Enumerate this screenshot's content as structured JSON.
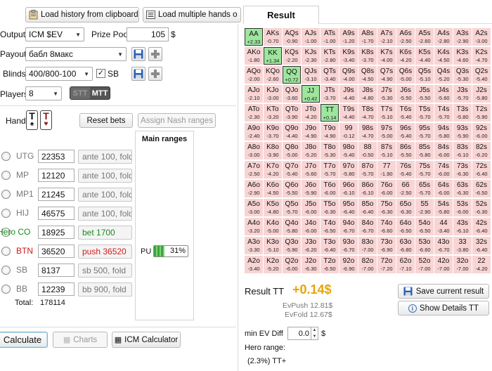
{
  "toolbar": {
    "load_clipboard": "Load history from clipboard",
    "load_multiple": "Load multiple hands o"
  },
  "result_tab": "Result",
  "settings": {
    "output_label": "Output",
    "output_value": "ICM $EV",
    "prize_pool_label": "Prize Pool",
    "prize_pool_value": "105",
    "currency": "$",
    "payout_label": "Payout",
    "payout_value": "бабл 8макс",
    "blinds_label": "Blinds",
    "blinds_value": "400/800-100",
    "sb_label": "SB",
    "players_label": "Players",
    "players_value": "8",
    "stt_label": "STT",
    "mtt_label": "MTT"
  },
  "hand": {
    "label": "Hand",
    "card1": "T",
    "card2": "T",
    "reset_bets": "Reset bets",
    "assign_nash": "Assign Nash ranges"
  },
  "main_ranges": {
    "title": "Main ranges",
    "pu_label": "PU",
    "pu_percent": "31%",
    "pu_fill": 0.31
  },
  "players": [
    {
      "pos": "UTG",
      "stack": "22353",
      "action": "ante 100, fold",
      "color": "gray"
    },
    {
      "pos": "MP",
      "stack": "12120",
      "action": "ante 100, fold",
      "color": "gray"
    },
    {
      "pos": "MP1",
      "stack": "21245",
      "action": "ante 100, fold",
      "color": "gray"
    },
    {
      "pos": "HIJ",
      "stack": "46575",
      "action": "ante 100, fold",
      "color": "gray"
    },
    {
      "pos": "Hero CO",
      "stack": "18925",
      "action": "bet 1700",
      "color": "green"
    },
    {
      "pos": "BTN",
      "stack": "36520",
      "action": "push 36520",
      "color": "red"
    },
    {
      "pos": "SB",
      "stack": "8137",
      "action": "sb 500, fold",
      "color": "gray"
    },
    {
      "pos": "BB",
      "stack": "12239",
      "action": "bb 900, fold",
      "color": "gray"
    }
  ],
  "total_label": "Total:",
  "total_value": "178114",
  "bottom": {
    "calculate": "Calculate",
    "charts": "Charts",
    "icm_calculator": "ICM Calculator"
  },
  "matrix": [
    [
      "AA|+2.33",
      "AKs|-0.70",
      "AQs|-0.90",
      "AJs|-1.00",
      "ATs|-1.00",
      "A9s|-1.20",
      "A8s|-1.70",
      "A7s|-2.10",
      "A6s|-2.50",
      "A5s|-2.60",
      "A4s|-2.80",
      "A3s|-2.90",
      "A2s|-3.00"
    ],
    [
      "AKo|-1.80",
      "KK|+1.34",
      "KQs|-2.20",
      "KJs|-2.30",
      "KTs|-2.80",
      "K9s|-3.40",
      "K8s|-3.70",
      "K7s|-4.00",
      "K6s|-4.20",
      "K5s|-4.40",
      "K4s|-4.50",
      "K3s|-4.60",
      "K2s|-4.70"
    ],
    [
      "AQo|-2.00",
      "KQo|-2.60",
      "QQ|+0.72",
      "QJs|-3.10",
      "QTs|-3.40",
      "Q9s|-4.00",
      "Q8s|-4.50",
      "Q7s|-4.90",
      "Q6s|-5.00",
      "Q5s|-5.10",
      "Q4s|-5.20",
      "Q3s|-5.30",
      "Q2s|-5.40"
    ],
    [
      "AJo|-2.10",
      "KJo|-3.00",
      "QJo|-3.60",
      "JJ|+0.42",
      "JTs|-3.70",
      "J9s|-4.40",
      "J8s|-4.80",
      "J7s|-5.30",
      "J6s|-5.50",
      "J5s|-5.50",
      "J4s|-5.60",
      "J3s|-5.70",
      "J2s|-5.80"
    ],
    [
      "ATo|-2.30",
      "KTo|-3.20",
      "QTo|-3.90",
      "JTo|-4.20",
      "TT|+0.14",
      "T9s|-4.40",
      "T8s|-4.70",
      "T7s|-5.10",
      "T6s|-5.40",
      "T5s|-5.70",
      "T4s|-5.70",
      "T3s|-5.80",
      "T2s|-5.90"
    ],
    [
      "A9o|-2.40",
      "K9o|-3.70",
      "Q9o|-4.40",
      "J9o|-4.90",
      "T9o|-4.90",
      "99|-0.12",
      "98s|-4.70",
      "97s|-5.00",
      "96s|-5.40",
      "95s|-5.70",
      "94s|-5.80",
      "93s|-5.90",
      "92s|-6.00"
    ],
    [
      "A8o|-3.00",
      "K8o|-3.90",
      "Q8o|-5.00",
      "J8o|-5.20",
      "T8o|-5.30",
      "98o|-5.40",
      "88|-0.50",
      "87s|-5.10",
      "86s|-5.50",
      "85s|-5.80",
      "84s|-6.00",
      "83s|-6.10",
      "82s|-6.20"
    ],
    [
      "A7o|-2.50",
      "K7o|-4.20",
      "Q7o|-5.40",
      "J7o|-5.60",
      "T7o|-5.70",
      "97o|-5.80",
      "87o|-5.70",
      "77|-1.90",
      "76s|-5.40",
      "75s|-5.70",
      "74s|-6.00",
      "73s|-6.30",
      "72s|-6.40"
    ],
    [
      "A6o|-2.90",
      "K6o|-4.50",
      "Q6o|-5.50",
      "J6o|-5.90",
      "T6o|-6.00",
      "96o|-6.10",
      "86o|-6.10",
      "76o|-6.00",
      "66|-2.50",
      "65s|-5.70",
      "64s|-6.00",
      "63s|-6.30",
      "62s|-6.50"
    ],
    [
      "A5o|-3.00",
      "K5o|-4.80",
      "Q5o|-5.70",
      "J5o|-6.00",
      "T5o|-6.30",
      "95o|-6.40",
      "85o|-6.40",
      "75o|-6.30",
      "65o|-6.30",
      "55|-2.90",
      "54s|-5.80",
      "53s|-6.00",
      "52s|-6.30"
    ],
    [
      "A4o|-3.20",
      "K4o|-5.00",
      "Q4o|-5.80",
      "J4o|-6.00",
      "T4o|-6.50",
      "94o|-6.70",
      "84o|-6.70",
      "74o|-6.60",
      "64o|-6.50",
      "54o|-6.50",
      "44|-3.40",
      "43s|-6.10",
      "42s|-6.40"
    ],
    [
      "A3o|-3.30",
      "K3o|-5.10",
      "Q3o|-5.90",
      "J3o|-6.20",
      "T3o|-6.40",
      "93o|-6.70",
      "83o|-7.00",
      "73o|-6.90",
      "63o|-6.80",
      "53o|-6.60",
      "43o|-6.70",
      "33|-3.80",
      "32s|-6.40"
    ],
    [
      "A2o|-3.40",
      "K2o|-5.20",
      "Q2o|-6.00",
      "J2o|-6.30",
      "T2o|-6.50",
      "92o|-6.90",
      "82o|-7.00",
      "72o|-7.20",
      "62o|-7.10",
      "52o|-7.00",
      "42o|-7.00",
      "32o|-7.00",
      "22|-4.20"
    ]
  ],
  "result": {
    "label": "Result TT",
    "value": "+0.14$",
    "evpush": "EvPush 12.81$",
    "evfold": "EvFold 12.67$",
    "save_button": "Save current result",
    "show_details": "Show Details TT",
    "min_ev_label": "min EV Diff",
    "min_ev_value": "0.0",
    "currency": "$",
    "hero_range_label": "Hero range:",
    "hero_range_value": "(2.3%) TT+"
  },
  "colors": {
    "fold_cell": "#f9d4d4",
    "push_cell": "#9ee59e",
    "result_value": "#e8a400",
    "hero_action": "#1c8a1c",
    "villain_action": "#d21a1a"
  }
}
